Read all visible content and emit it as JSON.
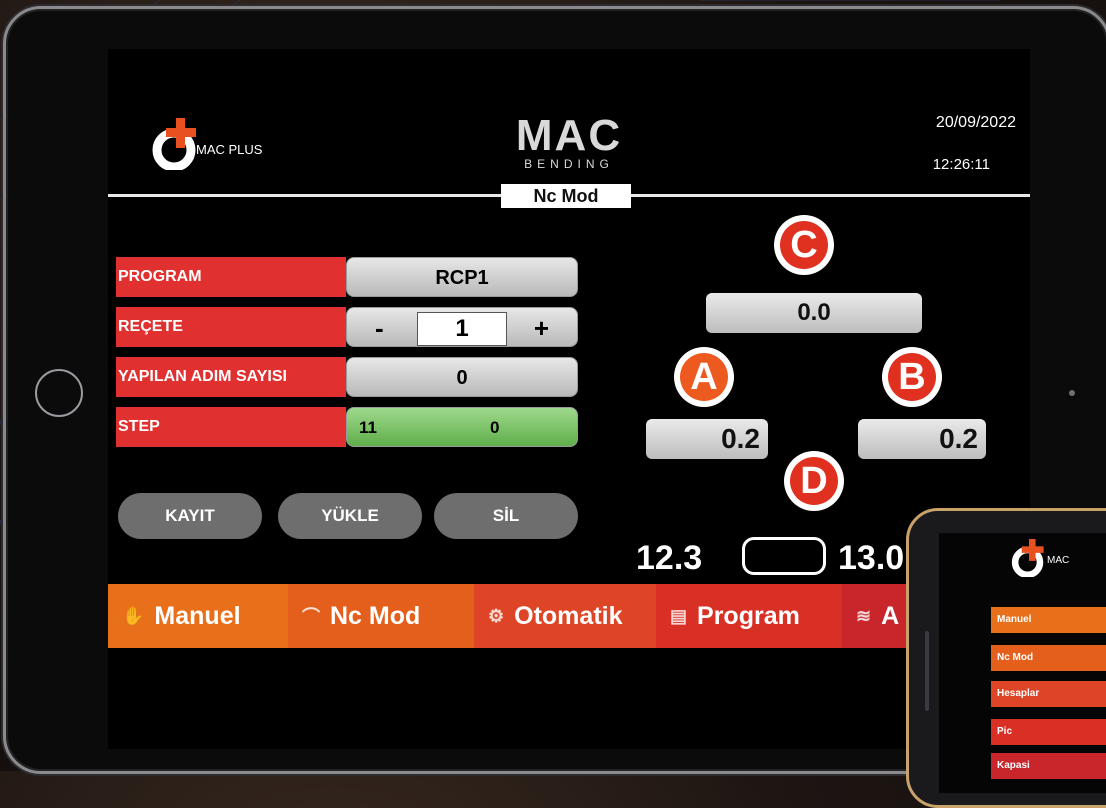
{
  "app": {
    "logo_text": "MAC PLUS",
    "brand_top": "MAC",
    "brand_bottom": "BENDING",
    "date": "20/09/2022",
    "time": "12:26:11",
    "mode_label": "Nc Mod"
  },
  "form": {
    "program_label": "PROGRAM",
    "program_value": "RCP1",
    "recete_label": "REÇETE",
    "recete_minus": "-",
    "recete_value": "1",
    "recete_plus": "+",
    "adim_label": "YAPILAN ADIM SAYISI",
    "adim_value": "0",
    "step_label": "STEP",
    "step_left": "11",
    "step_right": "0"
  },
  "buttons": {
    "kayit": "KAYIT",
    "yukle": "YÜKLE",
    "sil": "SİL"
  },
  "axes": {
    "c_label": "C",
    "c_value": "0.0",
    "a_label": "A",
    "a_value": "0.2",
    "b_label": "B",
    "b_value": "0.2",
    "d_label": "D",
    "bottom_left": "12.3",
    "bottom_right": "13.0"
  },
  "nav": {
    "manuel": "Manuel",
    "ncmod": "Nc Mod",
    "otomatik": "Otomatik",
    "program": "Program",
    "fifth": "A"
  },
  "phone": {
    "logo_text": "MAC",
    "menu": [
      "Manuel",
      "Nc Mod",
      "Hesaplar",
      "Pic",
      "Kapasi"
    ]
  },
  "colors": {
    "label_red": "#e03030",
    "nav_orange": "#e8701a",
    "nav_red": "#d93026",
    "step_green": "#7cc36a"
  }
}
